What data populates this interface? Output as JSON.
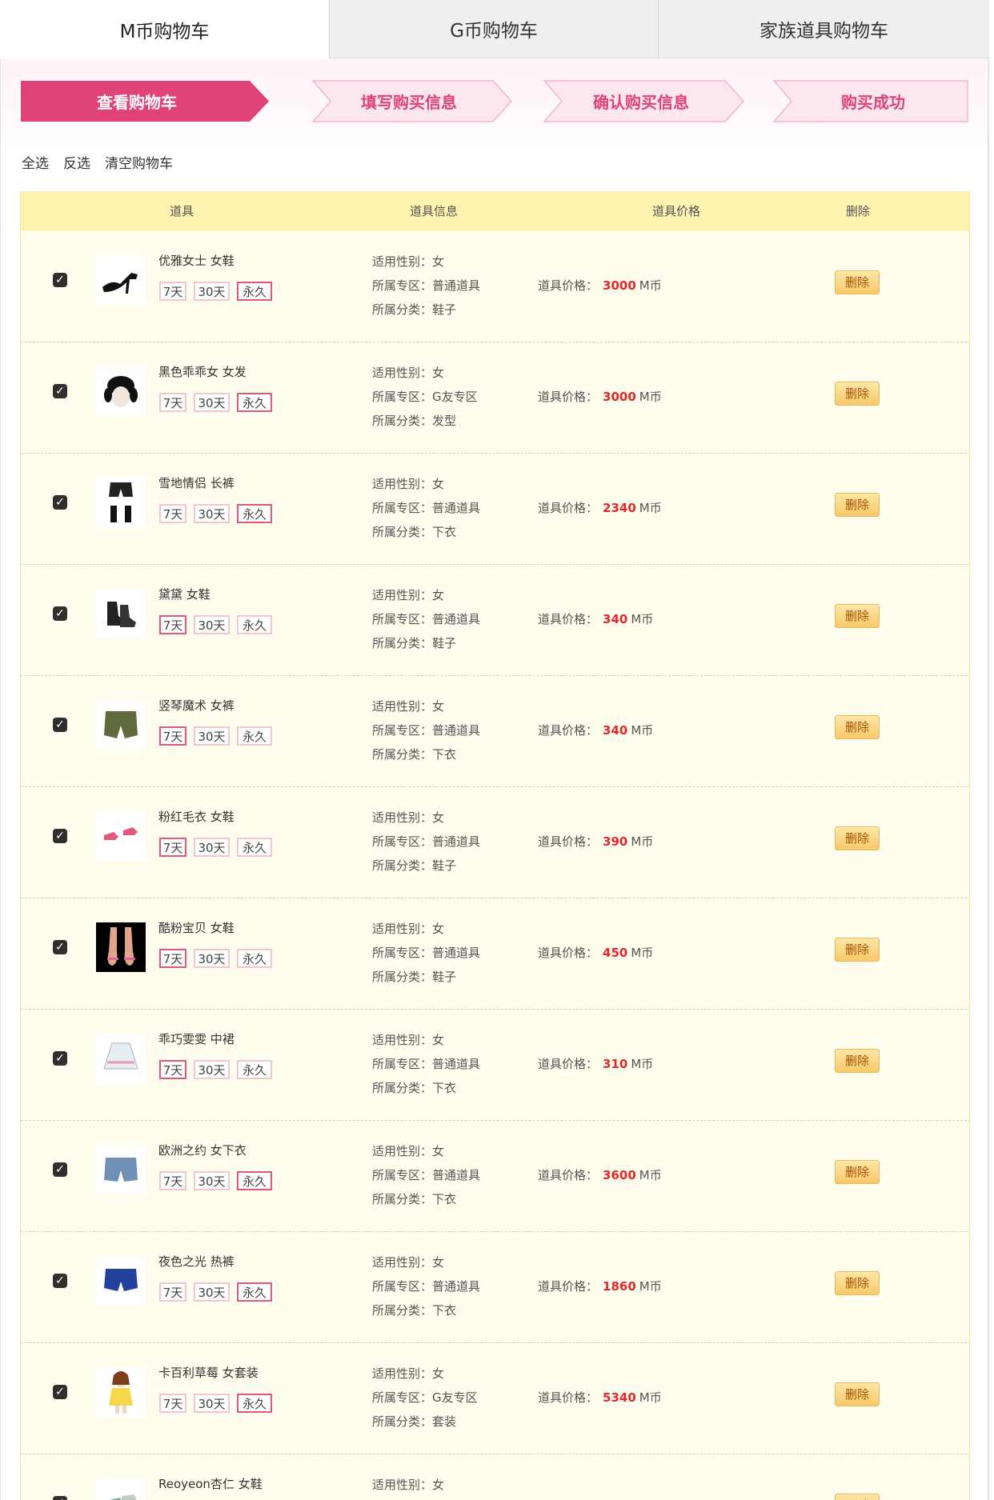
{
  "tabs": [
    {
      "label": "M币购物车"
    },
    {
      "label": "G币购物车"
    },
    {
      "label": "家族道具购物车"
    }
  ],
  "steps": [
    {
      "label": "查看购物车",
      "active": true
    },
    {
      "label": "填写购买信息",
      "active": false
    },
    {
      "label": "确认购买信息",
      "active": false
    },
    {
      "label": "购买成功",
      "active": false
    }
  ],
  "actions": {
    "select_all": "全选",
    "invert": "反选",
    "clear": "清空购物车"
  },
  "table": {
    "headers": {
      "item": "道具",
      "info": "道具信息",
      "price": "道具价格",
      "delete": "删除"
    },
    "field_labels": {
      "gender": "适用性别：",
      "zone": "所属专区：",
      "category": "所属分类：",
      "price": "道具价格："
    },
    "duration_options": {
      "d7": "7天",
      "d30": "30天",
      "perm": "永久"
    },
    "currency": "M币",
    "delete_label": "删除",
    "rows": [
      {
        "name": "优雅女士 女鞋",
        "gender": "女",
        "zone": "普通道具",
        "category": "鞋子",
        "price": "3000",
        "selected": "perm",
        "checked": true,
        "icon": "heels-icon"
      },
      {
        "name": "黑色乖乖女 女发",
        "gender": "女",
        "zone": "G友专区",
        "category": "发型",
        "price": "3000",
        "selected": "perm",
        "checked": true,
        "icon": "hair-icon"
      },
      {
        "name": "雪地情侣 长裤",
        "gender": "女",
        "zone": "普通道具",
        "category": "下衣",
        "price": "2340",
        "selected": "perm",
        "checked": true,
        "icon": "pants-icon"
      },
      {
        "name": "黛黛 女鞋",
        "gender": "女",
        "zone": "普通道具",
        "category": "鞋子",
        "price": "340",
        "selected": "d7",
        "checked": true,
        "icon": "boots-icon"
      },
      {
        "name": "竖琴魔术 女裤",
        "gender": "女",
        "zone": "普通道具",
        "category": "下衣",
        "price": "340",
        "selected": "d7",
        "checked": true,
        "icon": "shorts-icon"
      },
      {
        "name": "粉红毛衣 女鞋",
        "gender": "女",
        "zone": "普通道具",
        "category": "鞋子",
        "price": "390",
        "selected": "d7",
        "checked": true,
        "icon": "sneakers-icon"
      },
      {
        "name": "酷粉宝贝 女鞋",
        "gender": "女",
        "zone": "普通道具",
        "category": "鞋子",
        "price": "450",
        "selected": "d7",
        "checked": true,
        "icon": "sandals-icon"
      },
      {
        "name": "乖巧雯雯 中裙",
        "gender": "女",
        "zone": "普通道具",
        "category": "下衣",
        "price": "310",
        "selected": "d7",
        "checked": true,
        "icon": "skirt-icon"
      },
      {
        "name": "欧洲之约 女下衣",
        "gender": "女",
        "zone": "普通道具",
        "category": "下衣",
        "price": "3600",
        "selected": "perm",
        "checked": true,
        "icon": "denim-shorts-icon"
      },
      {
        "name": "夜色之光 热裤",
        "gender": "女",
        "zone": "普通道具",
        "category": "下衣",
        "price": "1860",
        "selected": "perm",
        "checked": true,
        "icon": "hotpants-icon"
      },
      {
        "name": "卡百利草莓 女套装",
        "gender": "女",
        "zone": "G友专区",
        "category": "套装",
        "price": "5340",
        "selected": "perm",
        "checked": true,
        "icon": "outfit-icon"
      },
      {
        "name": "Reoyeon杏仁 女鞋",
        "gender": "女",
        "zone": "",
        "category": "",
        "price": "",
        "selected": "",
        "checked": true,
        "icon": "shoes-icon"
      }
    ]
  },
  "colors": {
    "accent": "#e0427a",
    "price": "#e02a2a",
    "header_bg": "#fdf2b0",
    "row_bg": "#fffdee"
  }
}
